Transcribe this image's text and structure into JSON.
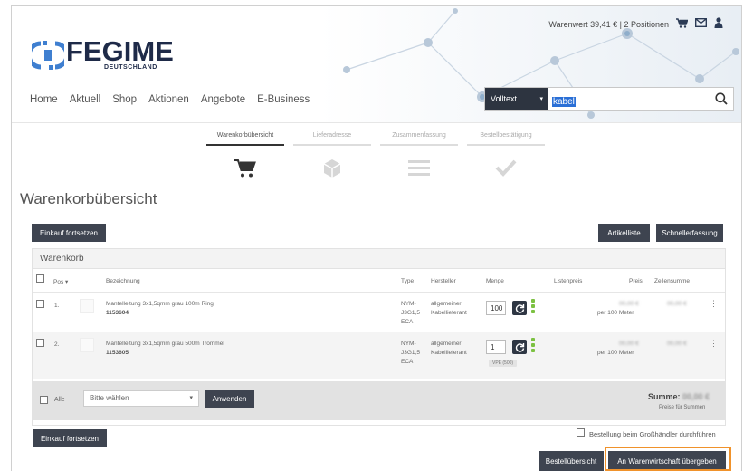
{
  "topbar": {
    "cart_value": "Warenwert 39,41 € | 2 Positionen",
    "cart_icon": "cart-icon",
    "mail_icon": "mail-icon",
    "user_icon": "user-icon"
  },
  "logo": {
    "brand": "FEGIME",
    "sub": "DEUTSCHLAND"
  },
  "nav": [
    "Home",
    "Aktuell",
    "Shop",
    "Aktionen",
    "Angebote",
    "E-Business"
  ],
  "search": {
    "mode": "Volltext",
    "value": "kabel",
    "icon": "search-icon"
  },
  "steps": [
    {
      "label": "Warenkorbübersicht",
      "icon": "cart-icon",
      "active": true
    },
    {
      "label": "Lieferadresse",
      "icon": "box-icon",
      "active": false
    },
    {
      "label": "Zusammenfassung",
      "icon": "list-icon",
      "active": false
    },
    {
      "label": "Bestellbestätigung",
      "icon": "check-icon",
      "active": false
    }
  ],
  "page_title": "Warenkorbübersicht",
  "buttons": {
    "continue_shopping": "Einkauf fortsetzen",
    "article_list": "Artikelliste",
    "quick_entry": "Schnellerfassung",
    "apply": "Anwenden",
    "order_overview": "Bestellübersicht",
    "transfer_cart": "An Warenwirtschaft übergeben"
  },
  "cart": {
    "title": "Warenkorb",
    "columns": {
      "pos": "Pos",
      "designation": "Bezeichnung",
      "type": "Type",
      "manufacturer": "Hersteller",
      "quantity": "Menge",
      "list_price": "Listenpreis",
      "price": "Preis",
      "line_total": "Zeilensumme"
    },
    "rows": [
      {
        "pos": "1.",
        "name": "Mantelleitung 3x1,5qmm grau 100m Ring",
        "number": "1153604",
        "type": "NYM-J3G1,5 ECA",
        "manufacturer": "allgemeiner Kabellieferant",
        "quantity": "100",
        "price": "00,00 €",
        "price_unit": "per 100 Meter",
        "line_total": "00,00 €",
        "badge": ""
      },
      {
        "pos": "2.",
        "name": "Mantelleitung 3x1,5qmm grau 500m Trommel",
        "number": "1153605",
        "type": "NYM-J3G1,5 ECA",
        "manufacturer": "allgemeiner Kabellieferant",
        "quantity": "1",
        "price": "00,00 €",
        "price_unit": "per 100 Meter",
        "line_total": "00,00 €",
        "badge": "VPE (500)"
      }
    ],
    "footer": {
      "all_label": "Alle",
      "select_placeholder": "Bitte wählen",
      "sum_label": "Summe:",
      "sum_value": "00,00 €",
      "sum_note": "Preise für Summen"
    }
  },
  "order_checkbox_label": "Bestellung beim Großhändler durchführen"
}
